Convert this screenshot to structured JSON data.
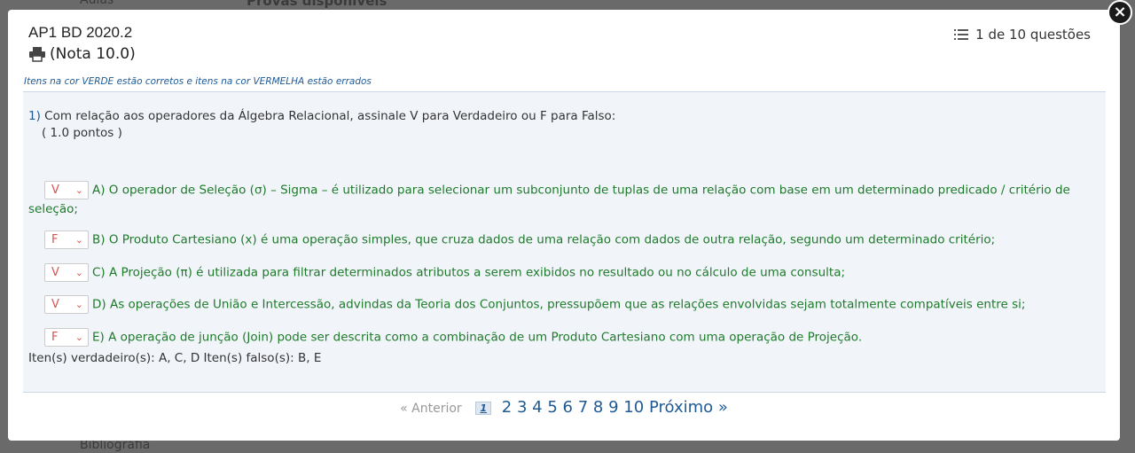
{
  "background": {
    "top_left_text": "Aulas",
    "top_center_text": "Provas disponíveis",
    "bottom_left_text": "Bibliografia"
  },
  "modal": {
    "title": "AP1 BD 2020.2",
    "grade": "(Nota 10.0)",
    "counter": "1 de 10 questões",
    "legend": "Itens na cor VERDE estão corretos e itens na cor VERMELHA estão errados",
    "close_glyph": "×"
  },
  "question": {
    "number": "1)",
    "text": "Com relação aos operadores da Álgebra Relacional, assinale V para Verdadeiro ou F para Falso:",
    "points": "( 1.0 pontos )",
    "items": [
      {
        "answer": "V",
        "text": "A) O operador de Seleção (σ) – Sigma – é utilizado para selecionar um subconjunto de tuplas de uma relação com base em um determinado predicado / critério de seleção;"
      },
      {
        "answer": "F",
        "text": "B) O Produto Cartesiano (x) é uma operação simples, que cruza dados de uma relação com dados de outra relação, segundo um determinado critério;"
      },
      {
        "answer": "V",
        "text": "C) A Projeção (π) é utilizada para filtrar determinados atributos a serem exibidos no resultado ou no cálculo de uma consulta;"
      },
      {
        "answer": "V",
        "text": "D) As operações de União e Intercessão, advindas da Teoria dos Conjuntos, pressupõem que as relações envolvidas sejam totalmente compatíveis entre si;"
      },
      {
        "answer": "F",
        "text": "E) A operação de junção (Join) pode ser descrita como a combinação de um Produto Cartesiano com uma operação de Projeção."
      }
    ],
    "summary": "Iten(s) verdadeiro(s): A, C, D Iten(s) falso(s): B, E"
  },
  "pagination": {
    "prev": "« Anterior",
    "current": "1",
    "pages": [
      "2",
      "3",
      "4",
      "5",
      "6",
      "7",
      "8",
      "9",
      "10"
    ],
    "next": "Próximo »"
  }
}
